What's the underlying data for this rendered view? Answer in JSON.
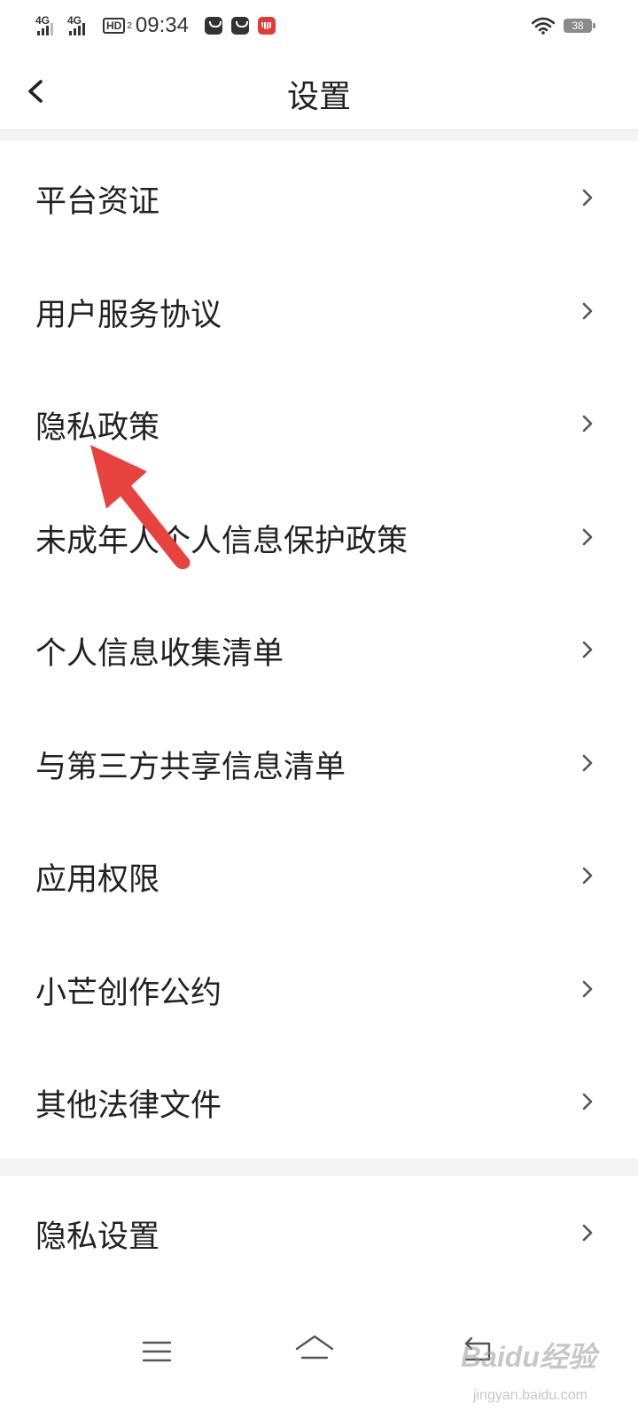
{
  "status_bar": {
    "signal_1_label": "4G",
    "signal_2_label": "4G",
    "hd_label": "HD",
    "hd_sub": "2",
    "time": "09:34",
    "battery_level": "38",
    "notification_icons": [
      "taobao-icon",
      "taobao-icon",
      "mgtv-app-icon"
    ],
    "accent_red": "#e53935"
  },
  "header": {
    "title": "设置",
    "back_icon": "chevron-left-icon"
  },
  "menu": {
    "items": [
      {
        "label": "平台资证"
      },
      {
        "label": "用户服务协议"
      },
      {
        "label": "隐私政策"
      },
      {
        "label": "未成年人个人信息保护政策"
      },
      {
        "label": "个人信息收集清单"
      },
      {
        "label": "与第三方共享信息清单"
      },
      {
        "label": "应用权限"
      },
      {
        "label": "小芒创作公约"
      },
      {
        "label": "其他法律文件"
      }
    ]
  },
  "privacy_section": {
    "items": [
      {
        "label": "隐私设置"
      }
    ]
  },
  "annotation": {
    "type": "arrow",
    "color": "#e8423f",
    "points_to": "隐私政策"
  },
  "nav_bar": {
    "icons": [
      "menu-icon",
      "home-icon",
      "back-icon"
    ]
  },
  "watermark": {
    "logo": "Baidu经验",
    "url": "jingyan.baidu.com"
  }
}
